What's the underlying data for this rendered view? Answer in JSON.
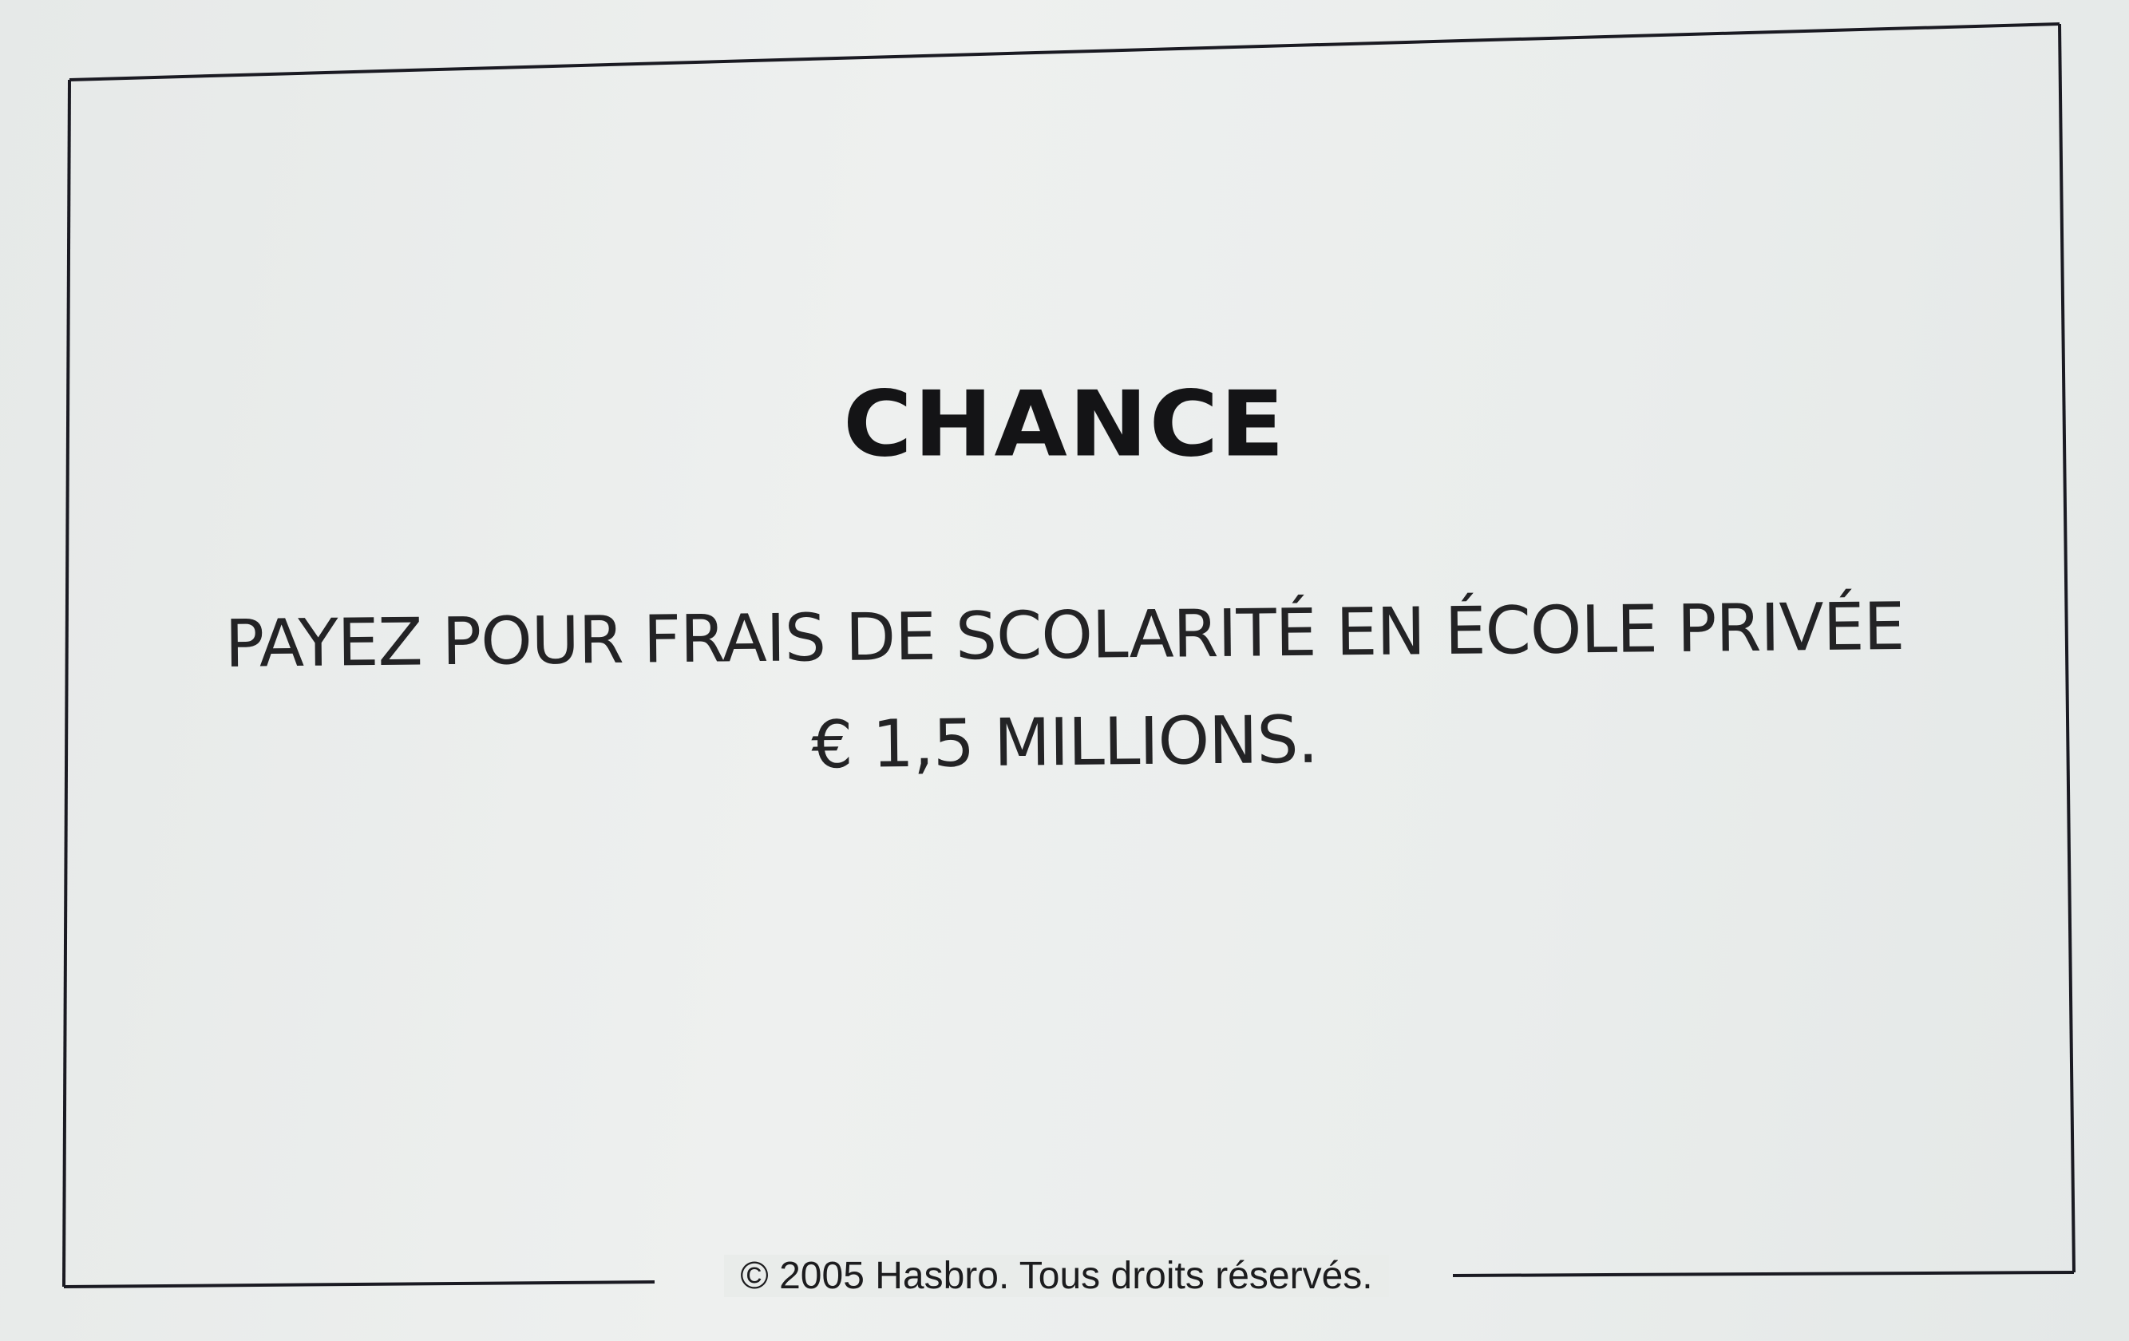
{
  "card": {
    "title": "CHANCE",
    "instruction_line_1": "PAYEZ POUR FRAIS DE SCOLARITÉ EN ÉCOLE PRIVÉE",
    "instruction_line_2": "€ 1,5 MILLIONS.",
    "copyright": "© 2005 Hasbro. Tous droits réservés."
  },
  "colors": {
    "background": "#e9ecea",
    "ink": "#141416",
    "border": "#1a1a22"
  }
}
